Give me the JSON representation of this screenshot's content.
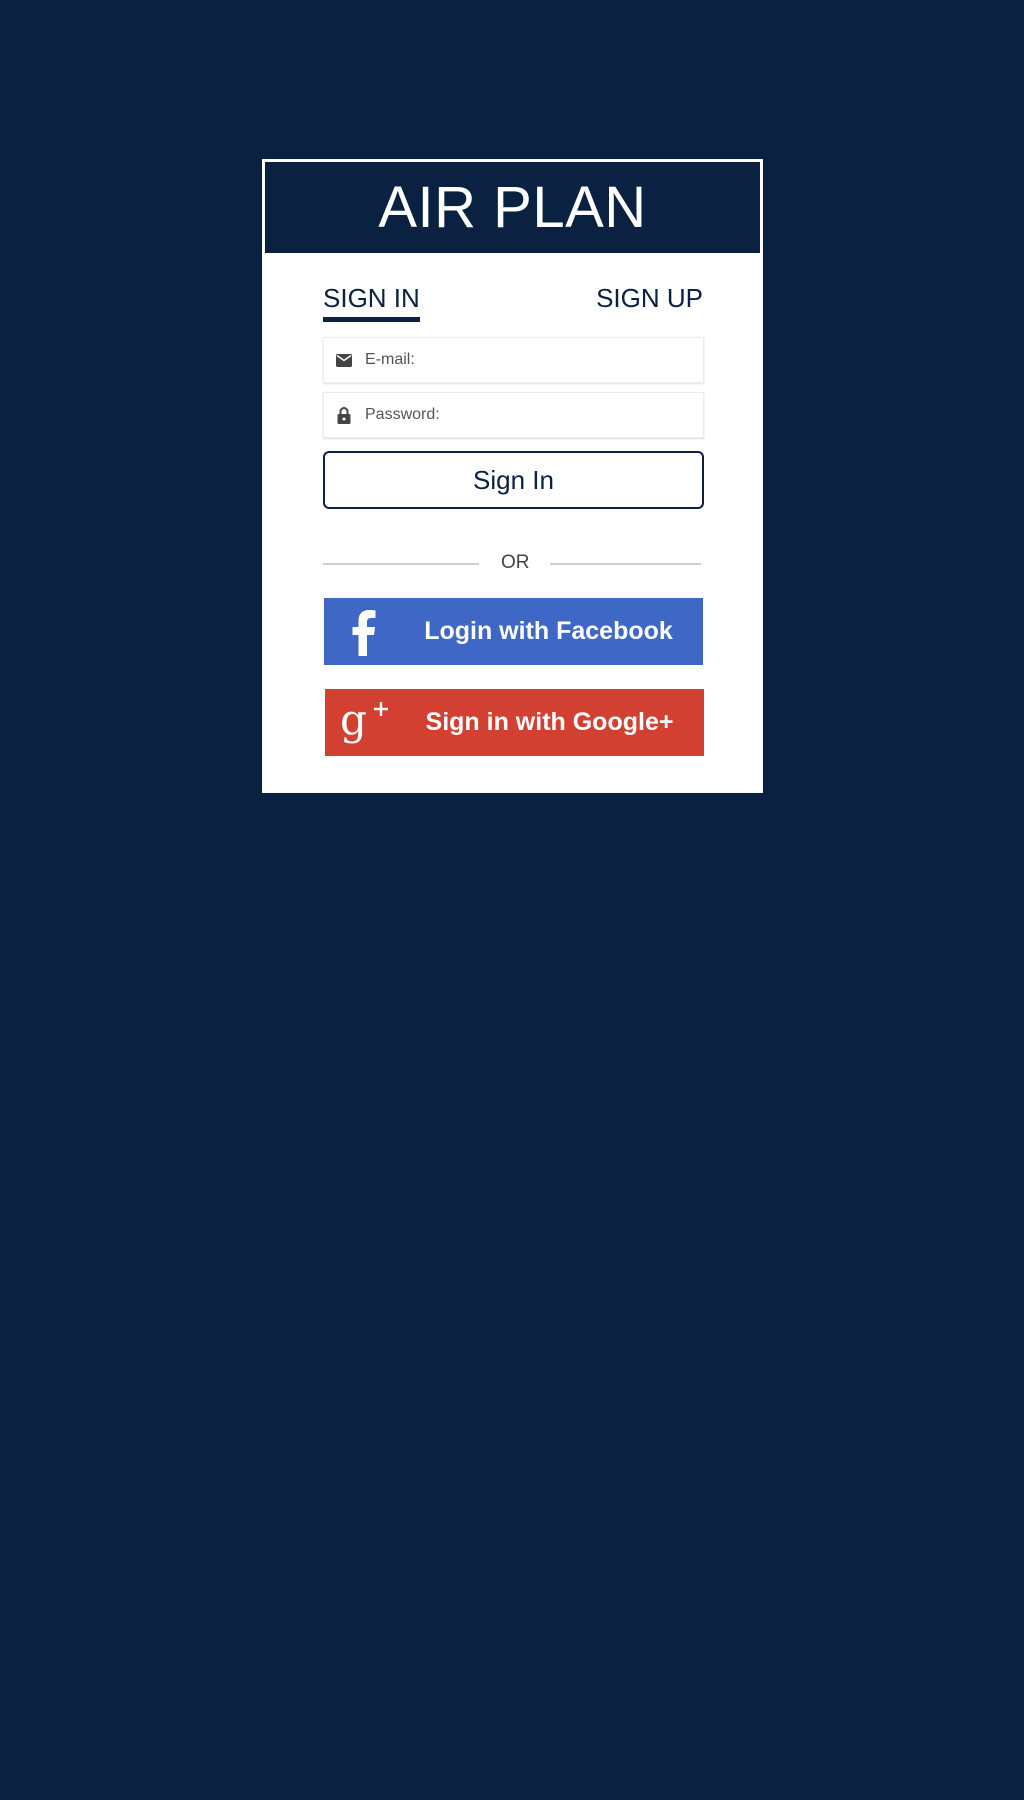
{
  "app": {
    "title": "AIR PLAN"
  },
  "tabs": {
    "signin_label": "SIGN IN",
    "signup_label": "SIGN UP",
    "active": "signin"
  },
  "form": {
    "email_placeholder": "E-mail:",
    "email_value": "",
    "password_placeholder": "Password:",
    "password_value": "",
    "submit_label": "Sign In"
  },
  "divider": {
    "label": "OR"
  },
  "social": {
    "facebook_label": "Login with Facebook",
    "google_label": "Sign in with Google+"
  },
  "icons": {
    "email": "envelope-icon",
    "password": "lock-icon",
    "facebook": "facebook-f-icon",
    "google": "google-plus-icon"
  },
  "colors": {
    "background": "#0a2142",
    "primary": "#0a2142",
    "facebook": "#3e67c6",
    "google": "#d14031",
    "card": "#ffffff"
  }
}
